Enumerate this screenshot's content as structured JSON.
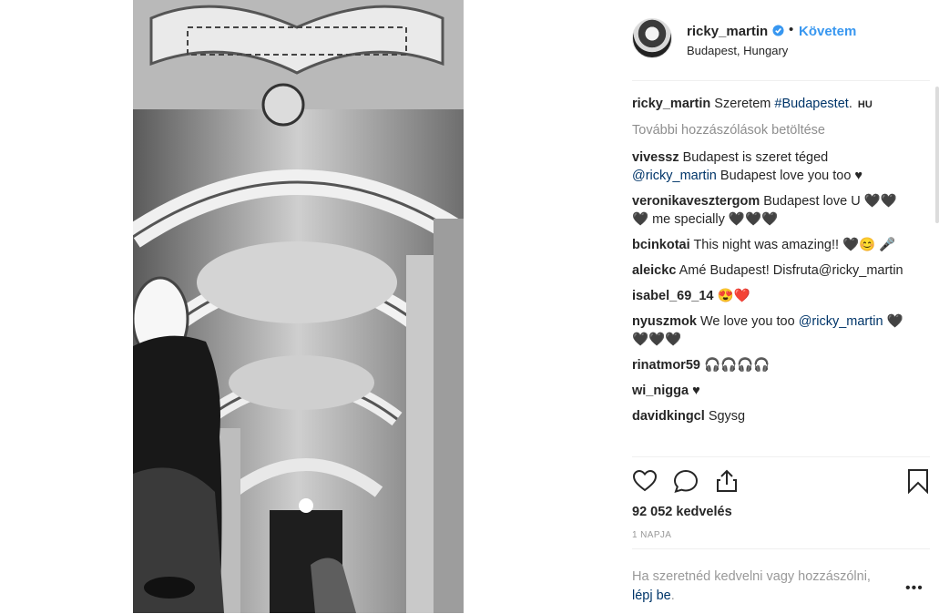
{
  "post": {
    "author": "ricky_martin",
    "follow_label": "Követem",
    "location": "Budapest, Hungary",
    "caption_text": "Szeretem ",
    "caption_hashtag": "#Budapestet",
    "caption_end": ". ",
    "caption_flag": "HU",
    "load_more": "További hozzászólások betöltése",
    "likes": "92 052 kedvelés",
    "time": "1 NAPJA"
  },
  "comments": [
    {
      "user": "vivessz",
      "pre": "Budapest is szeret téged ",
      "mention": "@ricky_martin",
      "post": " Budapest love you too ♥"
    },
    {
      "user": "veronikavesztergom",
      "pre": "Budapest love U 🖤🖤 🖤 me specially 🖤🖤🖤",
      "mention": "",
      "post": ""
    },
    {
      "user": "bcinkotai",
      "pre": "This night was amazing!! 🖤😊 🎤",
      "mention": "",
      "post": ""
    },
    {
      "user": "aleickc",
      "pre": "Amé Budapest! Disfruta@ricky_martin",
      "mention": "",
      "post": ""
    },
    {
      "user": "isabel_69_14",
      "pre": "😍❤️",
      "mention": "",
      "post": ""
    },
    {
      "user": "nyuszmok",
      "pre": "We love you too ",
      "mention": "@ricky_martin",
      "post": " 🖤🖤🖤🖤"
    },
    {
      "user": "rinatmor59",
      "pre": "🎧🎧🎧🎧",
      "mention": "",
      "post": ""
    },
    {
      "user": "wi_nigga",
      "pre": "♥",
      "mention": "",
      "post": ""
    },
    {
      "user": "davidkingcl",
      "pre": "Sgysg",
      "mention": "",
      "post": ""
    }
  ],
  "login": {
    "text": "Ha szeretnéd kedvelni vagy hozzászólni,",
    "link": "lépj be",
    "end": ".",
    "more": "•••"
  },
  "icons": {
    "verified": "verified-badge-icon",
    "like": "heart-icon",
    "comment": "comment-bubble-icon",
    "share": "share-icon",
    "save": "bookmark-icon"
  },
  "colors": {
    "accent": "#3897f0",
    "link": "#003569",
    "muted": "#999999"
  }
}
